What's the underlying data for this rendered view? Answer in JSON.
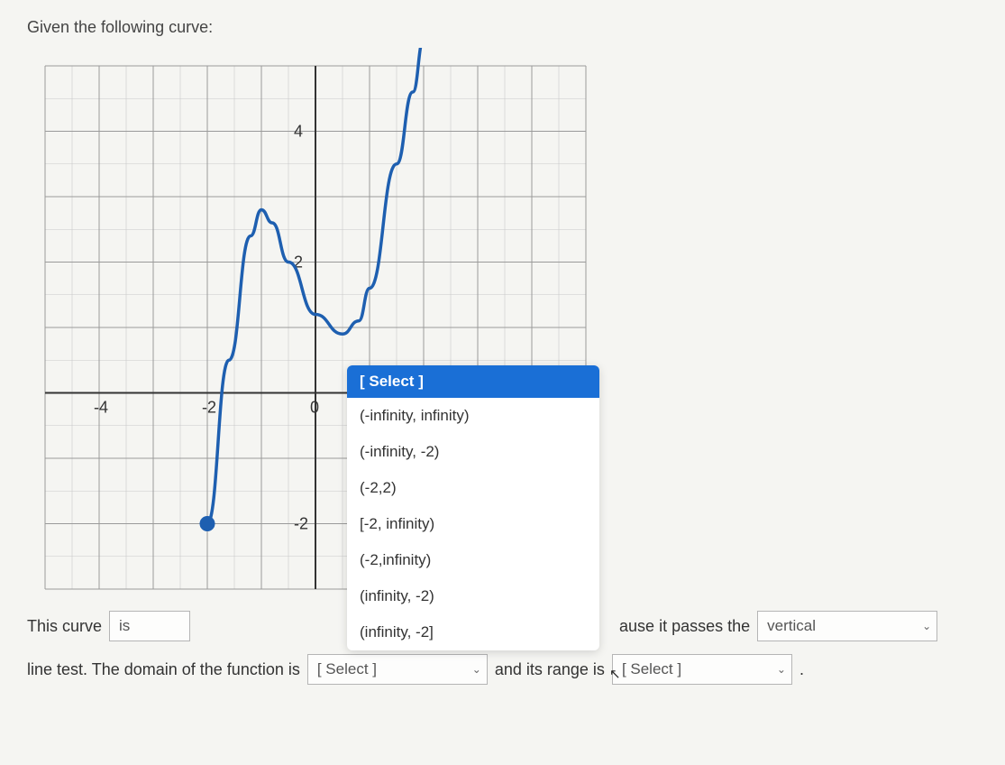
{
  "prompt": "Given the following curve:",
  "chart_data": {
    "type": "line",
    "title": "",
    "xlabel": "",
    "ylabel": "",
    "xlim": [
      -5,
      5
    ],
    "ylim": [
      -3,
      5
    ],
    "x_ticks": [
      -4,
      -2,
      0
    ],
    "y_ticks": [
      -2,
      0,
      2,
      4
    ],
    "series": [
      {
        "name": "curve",
        "x": [
          -2,
          -1.6,
          -1.2,
          -1.0,
          -0.8,
          -0.5,
          0.0,
          0.5,
          0.8,
          1.0,
          1.5,
          1.8,
          2.0
        ],
        "values": [
          -2,
          0.5,
          2.4,
          2.8,
          2.6,
          2.0,
          1.2,
          0.9,
          1.1,
          1.6,
          3.5,
          4.6,
          5.4
        ]
      }
    ],
    "endpoints": [
      {
        "x": -2,
        "y": -2,
        "filled": true
      },
      {
        "x": 2,
        "y": 5.4,
        "filled": true
      }
    ]
  },
  "dropdown": {
    "header": "[ Select ]",
    "options": [
      "(-infinity, infinity)",
      "(-infinity, -2)",
      "(-2,2)",
      "[-2, infinity)",
      "(-2,infinity)",
      "(infinity, -2)",
      "(infinity, -2]"
    ]
  },
  "sentence": {
    "s1_pre": "This curve",
    "sel_is": "is",
    "s1_mid_hidden": "ause it passes the",
    "sel_vertical": "vertical",
    "s2_pre": "line test. The domain of the function is",
    "sel_domain": "[ Select ]",
    "s2_mid": "and its range is",
    "sel_range": "[ Select ]",
    "period": "."
  }
}
